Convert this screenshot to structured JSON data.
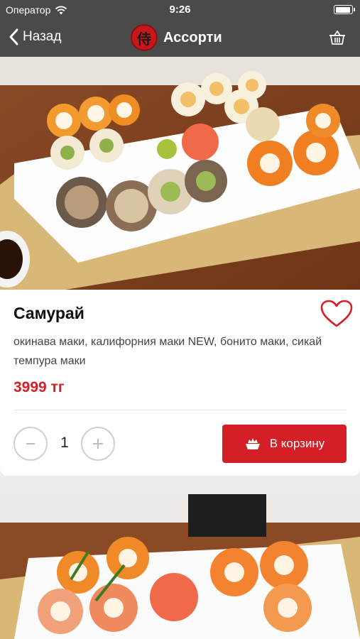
{
  "status_bar": {
    "carrier": "Оператор",
    "time": "9:26"
  },
  "nav": {
    "back_label": "Назад",
    "title": "Ассорти",
    "logo_glyph": "侍"
  },
  "product": {
    "name": "Самурай",
    "description": "окинава маки, калифорния маки NEW, бонито маки, сикай темпура маки",
    "price": "3999 тг",
    "quantity": "1",
    "add_to_cart_label": "В корзину",
    "favorite": false
  },
  "colors": {
    "nav_bg": "#4a4a4a",
    "accent": "#d41f26"
  },
  "icons": [
    "wifi-icon",
    "battery-icon",
    "back-chevron-icon",
    "basket-icon",
    "heart-icon",
    "minus-icon",
    "plus-icon",
    "sushi-boat-icon"
  ]
}
